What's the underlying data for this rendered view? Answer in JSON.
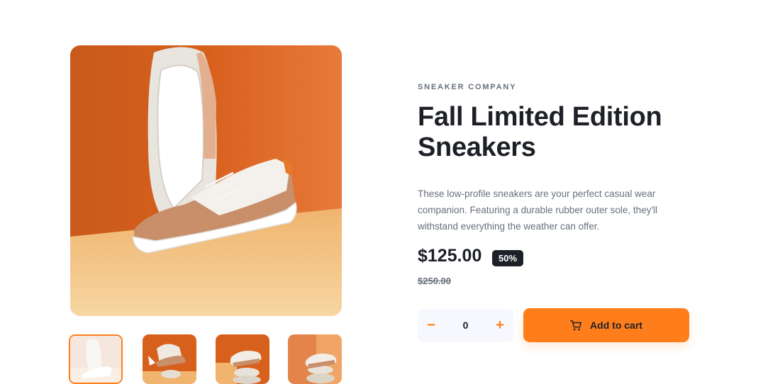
{
  "product": {
    "company": "SNEAKER COMPANY",
    "title_line1": "Fall Limited Edition",
    "title_line2": "Sneakers",
    "description": "These low-profile sneakers are your perfect casual wear companion. Featuring a durable rubber outer sole, they'll withstand everything the weather can offer.",
    "price": "$125.00",
    "discount": "50%",
    "original_price": "$250.00"
  },
  "cart": {
    "quantity": "0",
    "minus_label": "−",
    "plus_label": "+",
    "add_label": "Add to cart"
  },
  "gallery": {
    "active_thumbnail": 1,
    "thumbnails": [
      "thumbnail-1",
      "thumbnail-2",
      "thumbnail-3",
      "thumbnail-4"
    ]
  },
  "colors": {
    "accent": "#ff7e1b",
    "dark": "#1d2026",
    "muted": "#68707d",
    "light_bg": "#f6f8fd"
  },
  "icons": {
    "cart": "cart-icon",
    "minus": "minus-icon",
    "plus": "plus-icon"
  }
}
